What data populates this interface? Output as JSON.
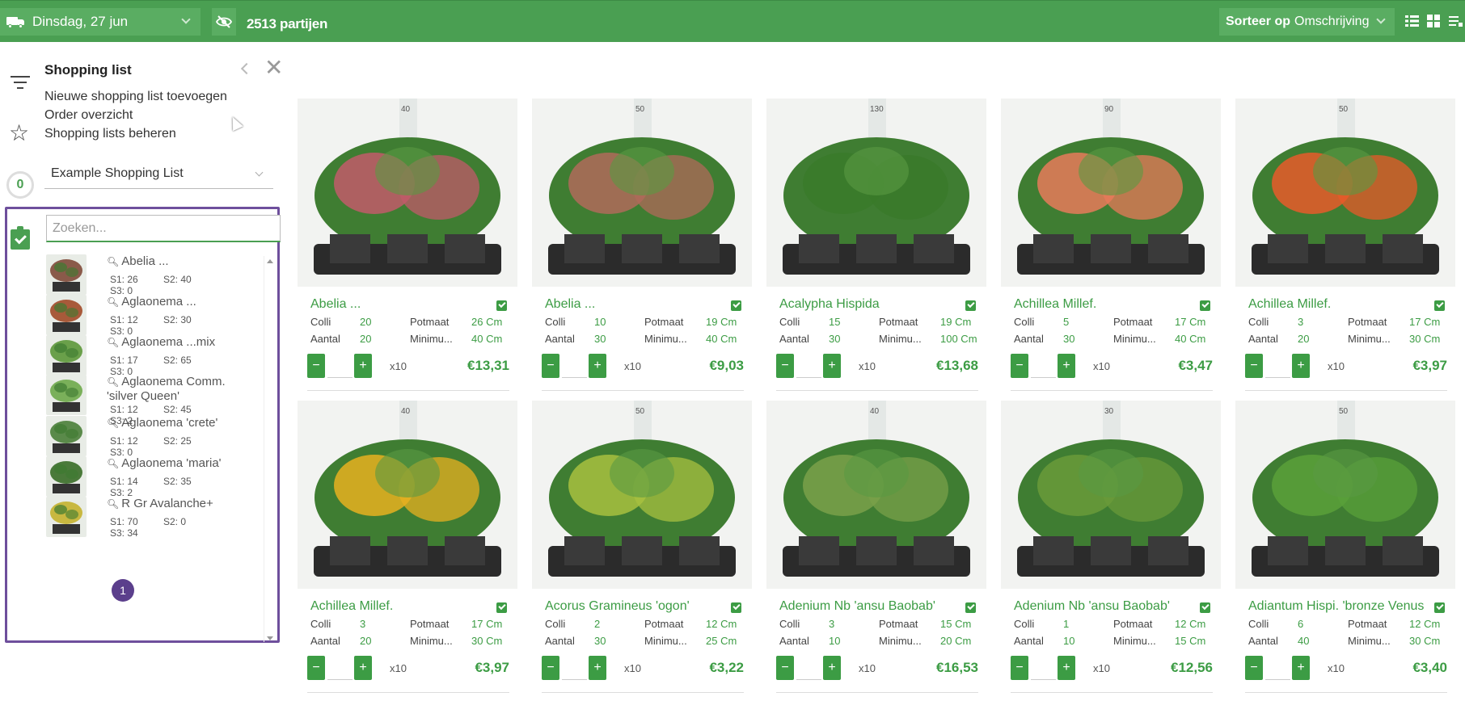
{
  "topbar": {
    "date": "Dinsdag, 27 jun",
    "count": "2513 partijen",
    "sort_prefix": "Sorteer op",
    "sort_value": "Omschrijving",
    "accent": "#4a9f52"
  },
  "sidebar": {
    "title": "Shopping list",
    "menu": [
      "Nieuwe shopping list toevoegen",
      "Order overzicht",
      "Shopping lists beheren"
    ],
    "badge_count": "0",
    "selected_list": "Example Shopping List",
    "search_placeholder": "Zoeken...",
    "items": [
      {
        "name": "Abelia ...",
        "s1": "S1: 26",
        "s2": "S2: 40",
        "s3": "S3: 0",
        "color": "#8a5a4a"
      },
      {
        "name": "Aglaonema ...",
        "s1": "S1: 12",
        "s2": "S2: 30",
        "s3": "S3: 0",
        "color": "#a85a3a"
      },
      {
        "name": "Aglaonema ...mix",
        "s1": "S1: 17",
        "s2": "S2: 65",
        "s3": "S3: 0",
        "color": "#6aa04a"
      },
      {
        "name": "Aglaonema Comm. 'silver Queen'",
        "s1": "S1: 12",
        "s2": "S2: 45",
        "s3": "S3: 2",
        "color": "#7ab05a"
      },
      {
        "name": "Aglaonema 'crete'",
        "s1": "S1: 12",
        "s2": "S2: 25",
        "s3": "S3: 0",
        "color": "#5a8a4a"
      },
      {
        "name": "Aglaonema 'maria'",
        "s1": "S1: 14",
        "s2": "S2: 35",
        "s3": "S3: 2",
        "color": "#4a7a3a"
      },
      {
        "name": "R Gr Avalanche+",
        "s1": "S1: 70",
        "s2": "S2: 0",
        "s3": "S3: 34",
        "color": "#c8b840"
      }
    ],
    "page": "1",
    "panel_color": "#6e4f9c"
  },
  "products": [
    {
      "name": "Abelia ...",
      "colli": "20",
      "potmaat": "26 Cm",
      "aantal": "20",
      "minimum": "40 Cm",
      "price": "€13,31",
      "mult": "x10",
      "ruler": "40",
      "color": "#c25a6a"
    },
    {
      "name": "Abelia ...",
      "colli": "10",
      "potmaat": "19 Cm",
      "aantal": "30",
      "minimum": "40 Cm",
      "price": "€9,03",
      "mult": "x10",
      "ruler": "50",
      "color": "#b06a5a"
    },
    {
      "name": "Acalypha Hispida",
      "colli": "15",
      "potmaat": "19 Cm",
      "aantal": "30",
      "minimum": "100 Cm",
      "price": "€13,68",
      "mult": "x10",
      "ruler": "130",
      "color": "#3a7a2a"
    },
    {
      "name": "Achillea Millef.",
      "colli": "5",
      "potmaat": "17 Cm",
      "aantal": "30",
      "minimum": "40 Cm",
      "price": "€3,47",
      "mult": "x10",
      "ruler": "90",
      "color": "#e87a5a"
    },
    {
      "name": "Achillea Millef.",
      "colli": "3",
      "potmaat": "17 Cm",
      "aantal": "20",
      "minimum": "30 Cm",
      "price": "€3,97",
      "mult": "x10",
      "ruler": "50",
      "color": "#e85a2a"
    },
    {
      "name": "Achillea Millef.",
      "colli": "3",
      "potmaat": "17 Cm",
      "aantal": "20",
      "minimum": "30 Cm",
      "price": "€3,97",
      "mult": "x10",
      "ruler": "40",
      "color": "#e8b020"
    },
    {
      "name": "Acorus Gramineus 'ogon'",
      "colli": "2",
      "potmaat": "12 Cm",
      "aantal": "30",
      "minimum": "25 Cm",
      "price": "€3,22",
      "mult": "x10",
      "ruler": "50",
      "color": "#a8c040"
    },
    {
      "name": "Adenium Nb 'ansu Baobab'",
      "colli": "3",
      "potmaat": "15 Cm",
      "aantal": "10",
      "minimum": "20 Cm",
      "price": "€16,53",
      "mult": "x10",
      "ruler": "40",
      "color": "#7aa04a"
    },
    {
      "name": "Adenium Nb 'ansu Baobab'",
      "colli": "1",
      "potmaat": "12 Cm",
      "aantal": "10",
      "minimum": "15 Cm",
      "price": "€12,56",
      "mult": "x10",
      "ruler": "30",
      "color": "#6a9a3a"
    },
    {
      "name": "Adiantum Hispi. 'bronze Venus",
      "colli": "6",
      "potmaat": "12 Cm",
      "aantal": "40",
      "minimum": "30 Cm",
      "price": "€3,40",
      "mult": "x10",
      "ruler": "50",
      "color": "#5aa03a"
    }
  ],
  "labels": {
    "colli": "Colli",
    "potmaat": "Potmaat",
    "aantal": "Aantal",
    "minimum": "Minimu...",
    "minus": "−",
    "plus": "+"
  }
}
